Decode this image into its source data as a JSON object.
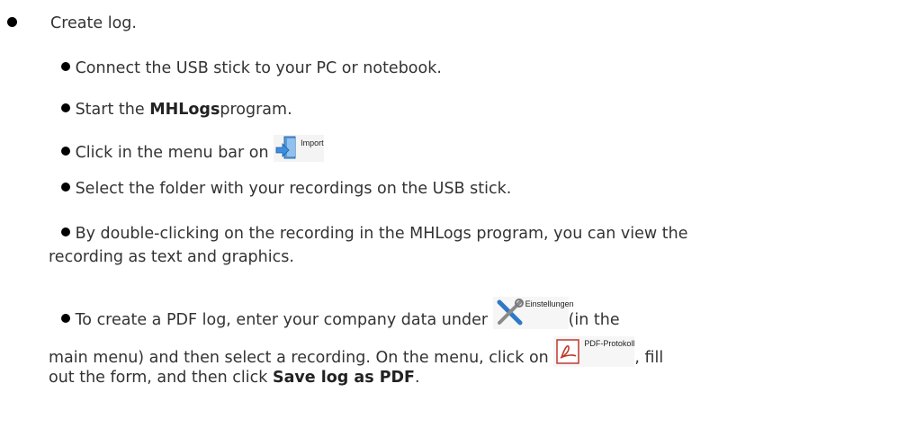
{
  "main_item": {
    "text": "Create log."
  },
  "steps": {
    "s1": {
      "text": "Connect the USB stick to your PC or notebook."
    },
    "s2": {
      "prefix": "Start the ",
      "bold": "MHLogs",
      "suffix": "program."
    },
    "s3": {
      "prefix": "Click in the menu bar on ",
      "icon": "import-icon",
      "icon_label": "Import"
    },
    "s4": {
      "text": "Select the folder with your recordings on the USB stick."
    },
    "s5": {
      "line1": "By double-clicking on the recording in the MHLogs program, you can view the",
      "line2": "recording as text and graphics."
    },
    "s6": {
      "prefix": "To create a PDF log, enter your company data under ",
      "icon1": "settings-tools-icon",
      "icon1_label": "Einstellungen",
      "middle": "(in the",
      "line2_prefix": "main menu) and then select a recording. On the menu, click on ",
      "icon2": "pdf-protocol-icon",
      "icon2_label": "PDF-Protokoll",
      "line2_suffix": ", fill",
      "line3_prefix": "out the form, and then click ",
      "line3_bold": "Save log as PDF",
      "line3_suffix": "."
    }
  }
}
